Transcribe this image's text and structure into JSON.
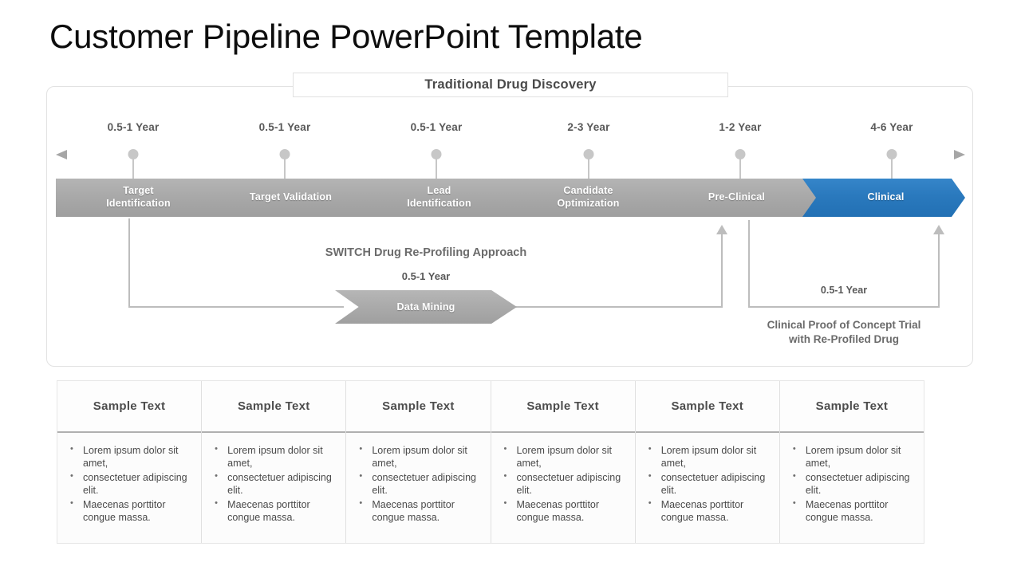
{
  "slide": {
    "title": "Customer Pipeline PowerPoint Template",
    "accent_color": "#2a79bd",
    "neutral_color": "#a9a9a9",
    "text_color": "#595959"
  },
  "diagram": {
    "header_chip": "Traditional Drug Discovery",
    "timeline_years": [
      "0.5-1 Year",
      "0.5-1 Year",
      "0.5-1 Year",
      "2-3 Year",
      "1-2 Year",
      "4-6 Year"
    ],
    "stages": [
      {
        "label": "Target Identification",
        "line1": "Target",
        "line2": "Identification",
        "color": "#a9a9a9",
        "highlighted": "false"
      },
      {
        "label": "Target Validation",
        "line1": "Target Validation",
        "line2": "",
        "color": "#a9a9a9",
        "highlighted": "false"
      },
      {
        "label": "Lead Identification",
        "line1": "Lead",
        "line2": "Identification",
        "color": "#a9a9a9",
        "highlighted": "false"
      },
      {
        "label": "Candidate Optimization",
        "line1": "Candidate",
        "line2": "Optimization",
        "color": "#a9a9a9",
        "highlighted": "false"
      },
      {
        "label": "Pre-Clinical",
        "line1": "Pre-Clinical",
        "line2": "",
        "color": "#a9a9a9",
        "highlighted": "false"
      },
      {
        "label": "Clinical",
        "line1": "Clinical",
        "line2": "",
        "color": "#2a79bd",
        "highlighted": "true"
      }
    ],
    "switch_branch": {
      "title": "SWITCH Drug Re-Profiling Approach",
      "year": "0.5-1 Year",
      "node_label": "Data Mining"
    },
    "poc_branch": {
      "year": "0.5-1 Year",
      "caption_line1": "Clinical  Proof of Concept Trial",
      "caption_line2": "with Re-Profiled Drug"
    }
  },
  "table": {
    "headers": [
      "Sample Text",
      "Sample Text",
      "Sample Text",
      "Sample Text",
      "Sample Text",
      "Sample Text"
    ],
    "bullets": [
      "Lorem ipsum dolor sit amet,",
      "consectetuer adipiscing elit.",
      "Maecenas porttitor congue massa."
    ]
  }
}
